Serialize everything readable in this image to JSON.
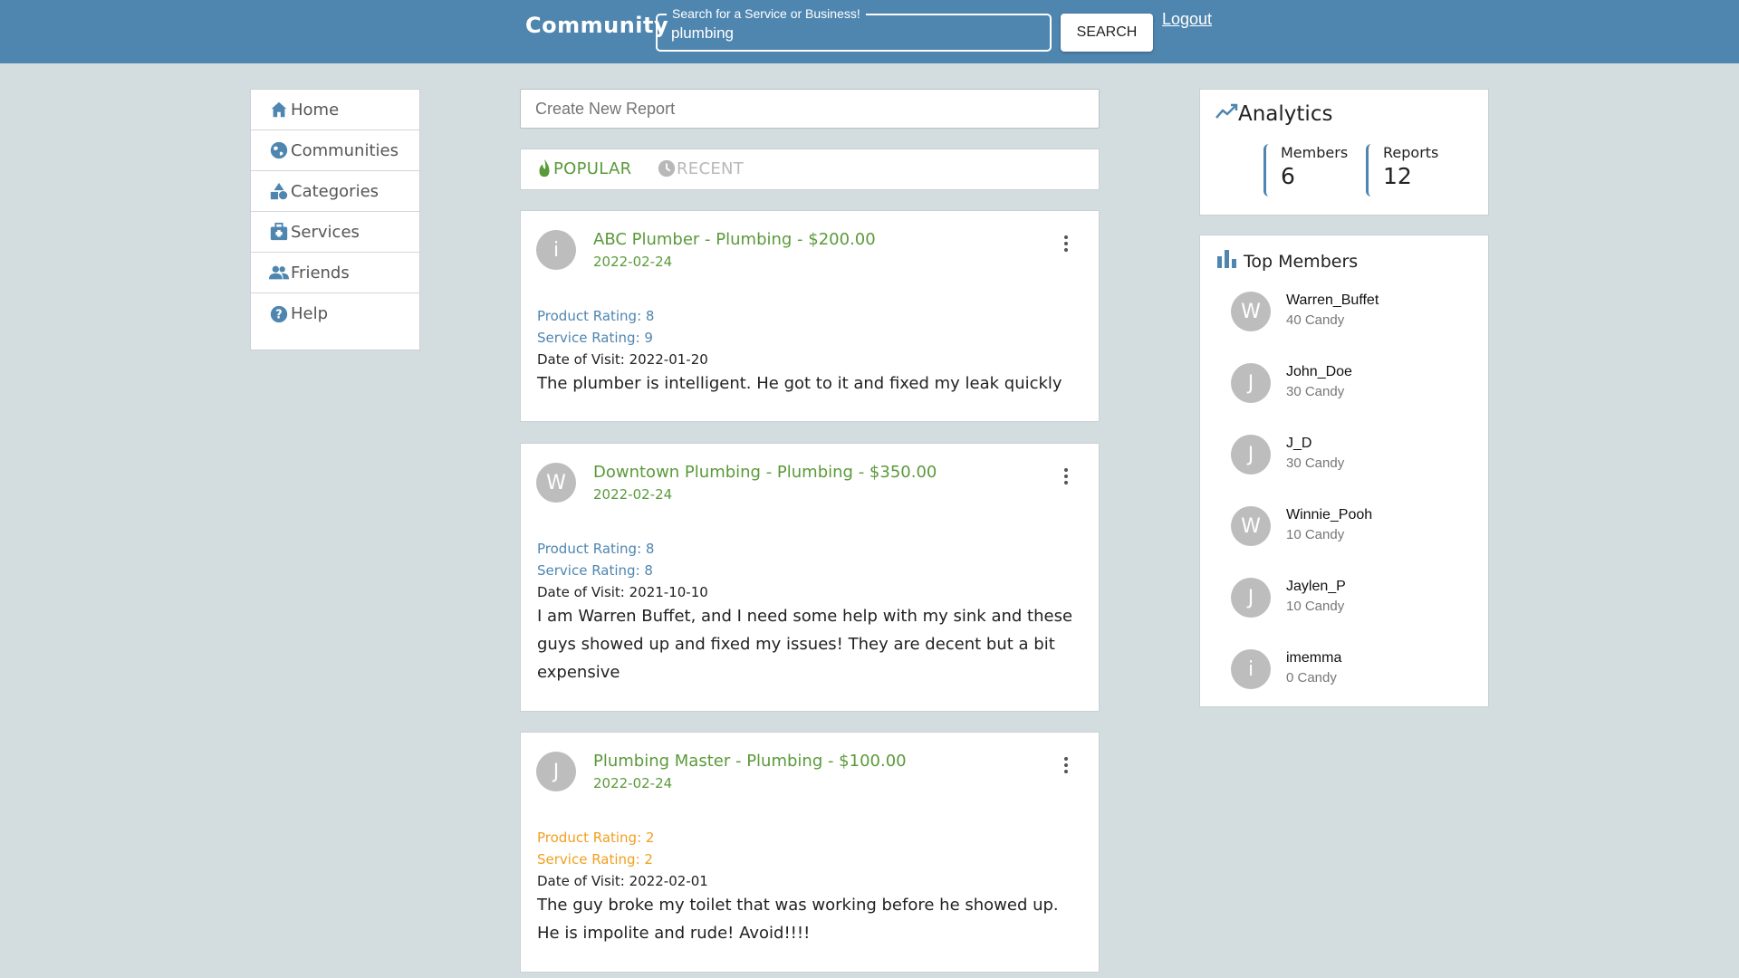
{
  "header": {
    "brand": "Community",
    "search_legend": "Search for a Service or Business!",
    "search_value": "plumbing",
    "search_button": "SEARCH",
    "logout": "Logout",
    "bg_color": "#4f86b0"
  },
  "sidebar": {
    "items": [
      {
        "label": "Home",
        "icon": "home-icon"
      },
      {
        "label": "Communities",
        "icon": "globe-icon"
      },
      {
        "label": "Categories",
        "icon": "shapes-icon"
      },
      {
        "label": "Services",
        "icon": "medkit-icon"
      },
      {
        "label": "Friends",
        "icon": "people-icon"
      },
      {
        "label": "Help",
        "icon": "help-icon"
      }
    ]
  },
  "create": {
    "placeholder": "Create New Report"
  },
  "tabs": {
    "popular": "POPULAR",
    "recent": "RECENT"
  },
  "reports": [
    {
      "avatar": "i",
      "title": "ABC Plumber - Plumbing - $200.00",
      "date": "2022-02-24",
      "product_rating": "Product Rating: 8",
      "service_rating": "Service Rating: 9",
      "visit": "Date of Visit: 2022-01-20",
      "body": "The plumber is intelligent. He got to it and fixed my leak quickly"
    },
    {
      "avatar": "W",
      "title": "Downtown Plumbing - Plumbing - $350.00",
      "date": "2022-02-24",
      "product_rating": "Product Rating: 8",
      "service_rating": "Service Rating: 8",
      "visit": "Date of Visit: 2021-10-10",
      "body": "I am Warren Buffet, and I need some help with my sink and these guys showed up and fixed my issues! They are decent but a bit expensive"
    },
    {
      "avatar": "J",
      "title": "Plumbing Master - Plumbing - $100.00",
      "date": "2022-02-24",
      "product_rating": "Product Rating: 2",
      "service_rating": "Service Rating: 2",
      "visit": "Date of Visit: 2022-02-01",
      "body": "The guy broke my toilet that was working before he showed up. He is impolite and rude! Avoid!!!!"
    }
  ],
  "analytics": {
    "title": "Analytics",
    "members_label": "Members",
    "members_value": "6",
    "reports_label": "Reports",
    "reports_value": "12"
  },
  "top_members": {
    "title": "Top Members",
    "list": [
      {
        "initial": "W",
        "name": "Warren_Buffet",
        "candy": "40 Candy"
      },
      {
        "initial": "J",
        "name": "John_Doe",
        "candy": "30 Candy"
      },
      {
        "initial": "J",
        "name": "J_D",
        "candy": "30 Candy"
      },
      {
        "initial": "W",
        "name": "Winnie_Pooh",
        "candy": "10 Candy"
      },
      {
        "initial": "J",
        "name": "Jaylen_P",
        "candy": "10 Candy"
      },
      {
        "initial": "i",
        "name": "imemma",
        "candy": "0 Candy"
      }
    ]
  },
  "colors": {
    "accent_blue": "#4f86b0",
    "accent_green": "#5a9a3a",
    "warn_orange": "#f0a020",
    "page_bg": "#d3dde0"
  }
}
